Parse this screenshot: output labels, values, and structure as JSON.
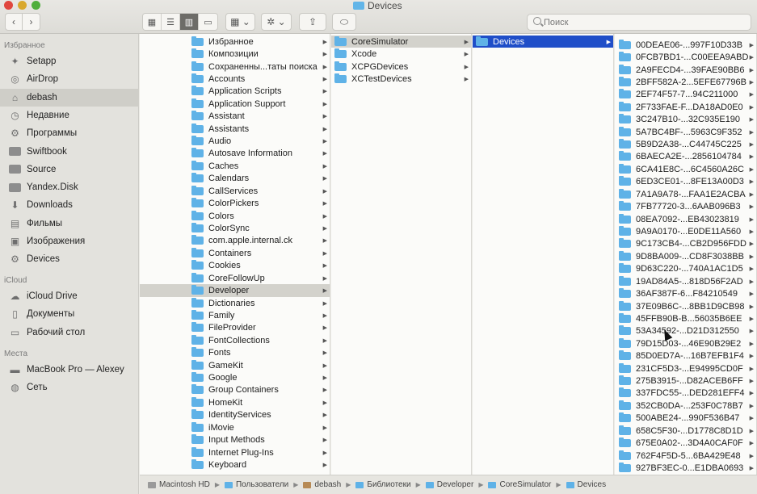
{
  "window": {
    "title": "Devices"
  },
  "toolbar": {
    "back_glyph": "‹",
    "forward_glyph": "›",
    "view_icons": [
      "icon-view",
      "list-view",
      "column-view",
      "gallery-view"
    ],
    "group_glyph": "▦ ⌄",
    "action_glyph": "✲ ⌄",
    "share_glyph": "⇪",
    "tag_glyph": "⬭",
    "search_placeholder": "Поиск"
  },
  "sidebar": {
    "favorites_header": "Избранное",
    "favorites": [
      {
        "label": "Setapp",
        "icon": "setapp-icon"
      },
      {
        "label": "AirDrop",
        "icon": "airdrop-icon"
      },
      {
        "label": "debash",
        "icon": "home-icon"
      },
      {
        "label": "Недавние",
        "icon": "recents-icon"
      },
      {
        "label": "Программы",
        "icon": "applications-icon"
      },
      {
        "label": "Swiftbook",
        "icon": "folder-icon"
      },
      {
        "label": "Source",
        "icon": "folder-icon"
      },
      {
        "label": "Yandex.Disk",
        "icon": "folder-icon"
      },
      {
        "label": "Downloads",
        "icon": "downloads-icon"
      },
      {
        "label": "Фильмы",
        "icon": "movies-icon"
      },
      {
        "label": "Изображения",
        "icon": "pictures-icon"
      },
      {
        "label": "Devices",
        "icon": "gear-icon"
      }
    ],
    "icloud_header": "iCloud",
    "icloud": [
      {
        "label": "iCloud Drive",
        "icon": "cloud-icon"
      },
      {
        "label": "Документы",
        "icon": "documents-icon"
      },
      {
        "label": "Рабочий стол",
        "icon": "desktop-icon"
      }
    ],
    "places_header": "Места",
    "places": [
      {
        "label": "MacBook Pro — Alexey",
        "icon": "laptop-icon"
      },
      {
        "label": "Сеть",
        "icon": "network-icon"
      }
    ],
    "col1": [
      "Избранное",
      "Композиции",
      "Сохраненны...таты поиска",
      "Accounts",
      "Application Scripts",
      "Application Support",
      "Assistant",
      "Assistants",
      "Audio",
      "Autosave Information",
      "Caches",
      "Calendars",
      "CallServices",
      "ColorPickers",
      "Colors",
      "ColorSync",
      "com.apple.internal.ck",
      "Containers",
      "Cookies",
      "CoreFollowUp",
      "Developer",
      "Dictionaries",
      "Family",
      "FileProvider",
      "FontCollections",
      "Fonts",
      "GameKit",
      "Google",
      "Group Containers",
      "HomeKit",
      "IdentityServices",
      "iMovie",
      "Input Methods",
      "Internet Plug-Ins",
      "Keyboard"
    ],
    "col2": [
      "CoreSimulator",
      "Xcode",
      "XCPGDevices",
      "XCTestDevices"
    ],
    "col3": [
      "Devices"
    ],
    "col4": [
      "00DEAE06-...997F10D33B",
      "0FCB7BD1-...C00EEA9ABD",
      "2A9FECD4-...39FAE90BB6",
      "2BFF582A-2...5EFE67796B",
      "2EF74F57-7...94C211000",
      "2F733FAE-F...DA18AD0E0",
      "3C247B10-...32C935E190",
      "5A7BC4BF-...5963C9F352",
      "5B9D2A38-...C44745C225",
      "6BAECA2E-...2856104784",
      "6CA41E8C-...6C4560A26C",
      "6ED3CE01-...8FE13A00D3",
      "7A1A9A78-...FAA1E2ACBA",
      "7FB77720-3...6AAB096B3",
      "08EA7092-...EB43023819",
      "9A9A0170-...E0DE11A560",
      "9C173CB4-...CB2D956FDD",
      "9D8BA009-...CD8F3038BB",
      "9D63C220-...740A1AC1D5",
      "19AD84A5-...818D56F2AD",
      "36AF387F-6...F84210549",
      "37E09B6C-...8BB1D9CB98",
      "45FFB90B-B...56035B6EE",
      "53A34592-...D21D312550",
      "79D15D03-...46E90B29E2",
      "85D0ED7A-...16B7EFB1F4",
      "231CF5D3-...E94995CD0F",
      "275B3915-...D82ACEB6FF",
      "337FDC55-...DED281EFF4",
      "352CB0DA-...253F0C78B7",
      "500ABE24-...990F536B47",
      "658C5F30-...D1778C8D1D",
      "675E0A02-...3D4A0CAF0F",
      "762F4F5D-5...6BA429E48",
      "927BF3EC-0...E1DBA0693"
    ]
  },
  "pathbar": [
    {
      "label": "Macintosh HD",
      "kind": "hd"
    },
    {
      "label": "Пользователи",
      "kind": "folder"
    },
    {
      "label": "debash",
      "kind": "home"
    },
    {
      "label": "Библиотеки",
      "kind": "folder"
    },
    {
      "label": "Developer",
      "kind": "folder"
    },
    {
      "label": "CoreSimulator",
      "kind": "folder"
    },
    {
      "label": "Devices",
      "kind": "folder"
    }
  ],
  "selection": {
    "col1_selected": "Developer",
    "col2_selected": "CoreSimulator",
    "col3_selected": "Devices"
  },
  "colors": {
    "selection_blue": "#1f4ec8",
    "folder_blue": "#5fb2e7",
    "selection_grey": "#d3d2cc"
  }
}
